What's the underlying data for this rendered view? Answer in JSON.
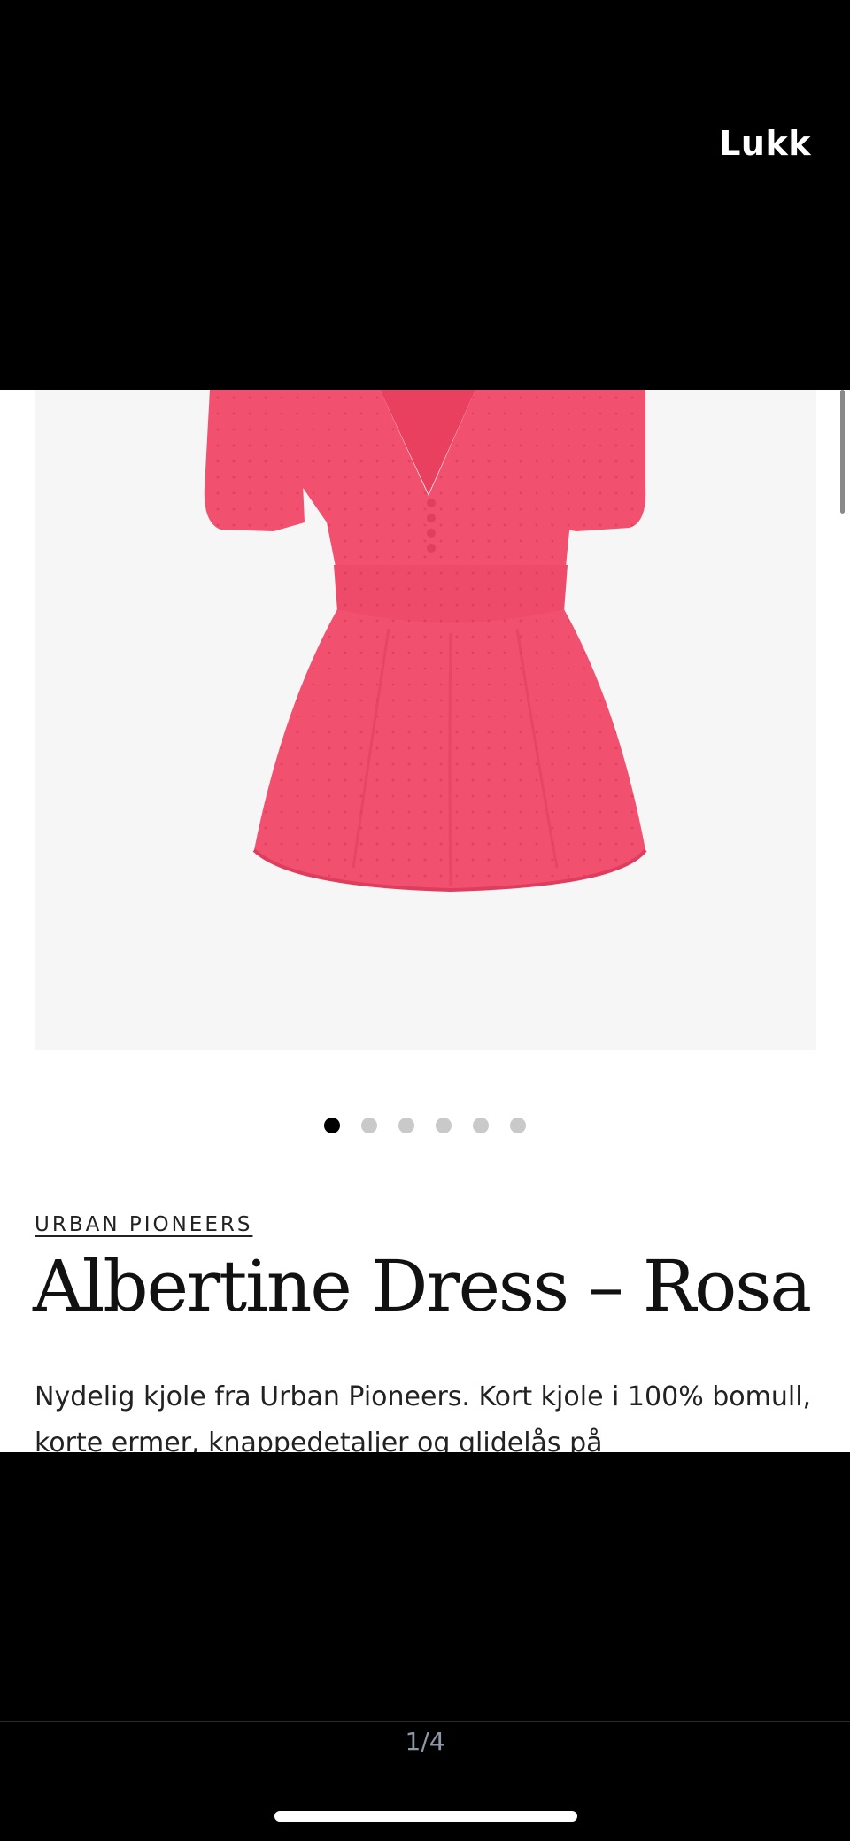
{
  "header": {
    "close_label": "Lukk"
  },
  "gallery": {
    "image_alt": "Albertine Dress – Rosa",
    "dress_color": "#f2506f",
    "dots_total": 6,
    "active_dot": 1
  },
  "product": {
    "brand": "URBAN PIONEERS",
    "title": "Albertine Dress – Rosa",
    "description": "Nydelig kjole fra Urban Pioneers. Kort kjole i 100% bomull, korte ermer, knappedetaljer og glidelås på"
  },
  "footer": {
    "page_counter": "1/4"
  }
}
